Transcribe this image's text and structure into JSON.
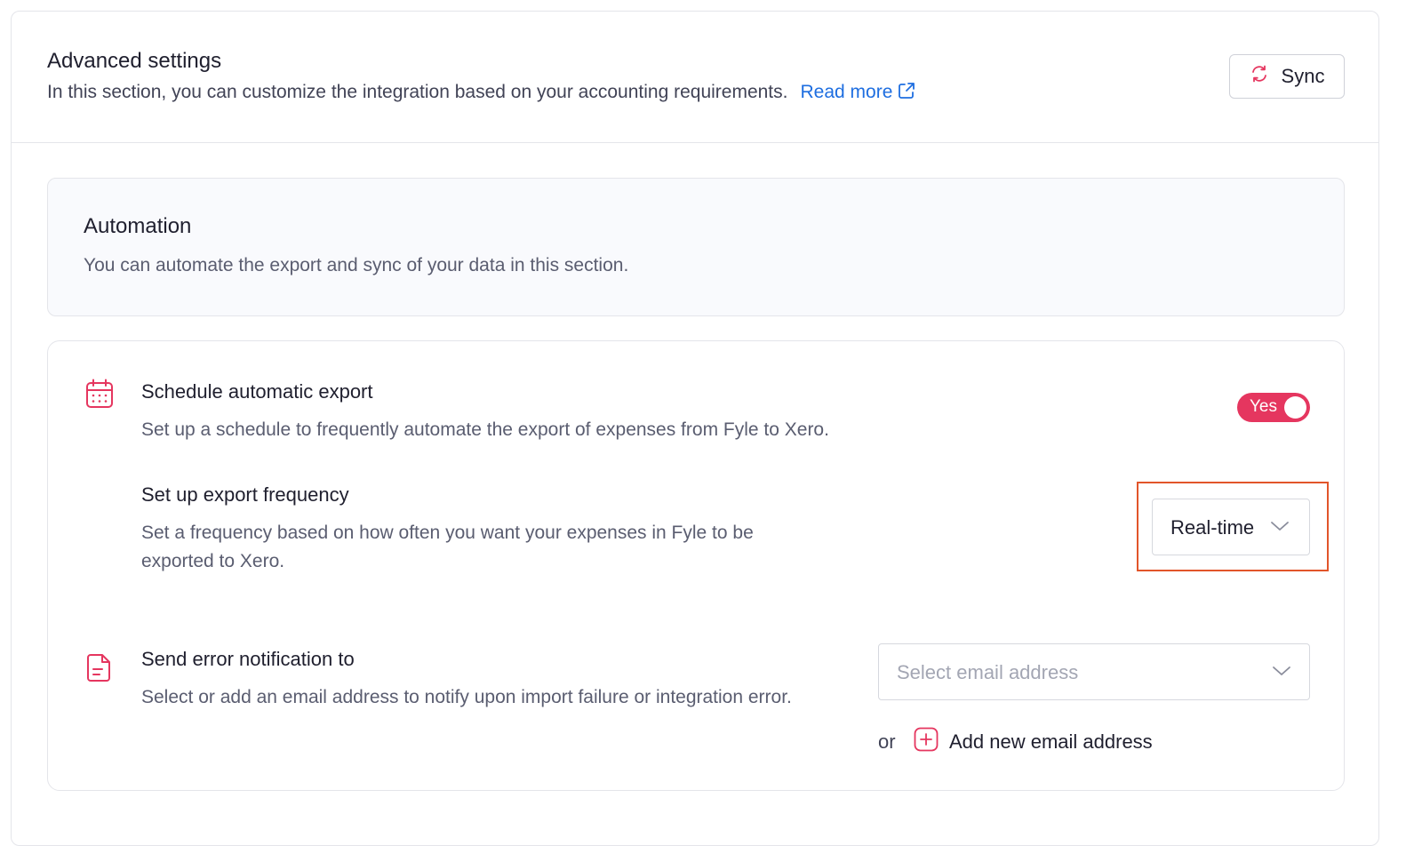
{
  "header": {
    "title": "Advanced settings",
    "subtitle": "In this section, you can customize the integration based on your accounting requirements.",
    "read_more": "Read more",
    "sync_label": "Sync"
  },
  "automation": {
    "title": "Automation",
    "subtitle": "You can automate the export and sync of your data in this section."
  },
  "schedule_export": {
    "title": "Schedule automatic export",
    "description": "Set up a schedule to frequently automate the export of expenses from Fyle to Xero.",
    "toggle_label": "Yes",
    "toggle_on": true
  },
  "export_frequency": {
    "title": "Set up export frequency",
    "description": "Set a frequency based on how often you want your expenses in Fyle to be exported to Xero.",
    "selected_value": "Real-time"
  },
  "error_notification": {
    "title": "Send error notification to",
    "description": "Select or add an email address to notify upon import failure or integration error.",
    "placeholder": "Select email address",
    "or_text": "or",
    "add_label": "Add new email address"
  },
  "colors": {
    "accent": "#e5365f",
    "link": "#1e6ee0",
    "highlight": "#e2552a"
  }
}
